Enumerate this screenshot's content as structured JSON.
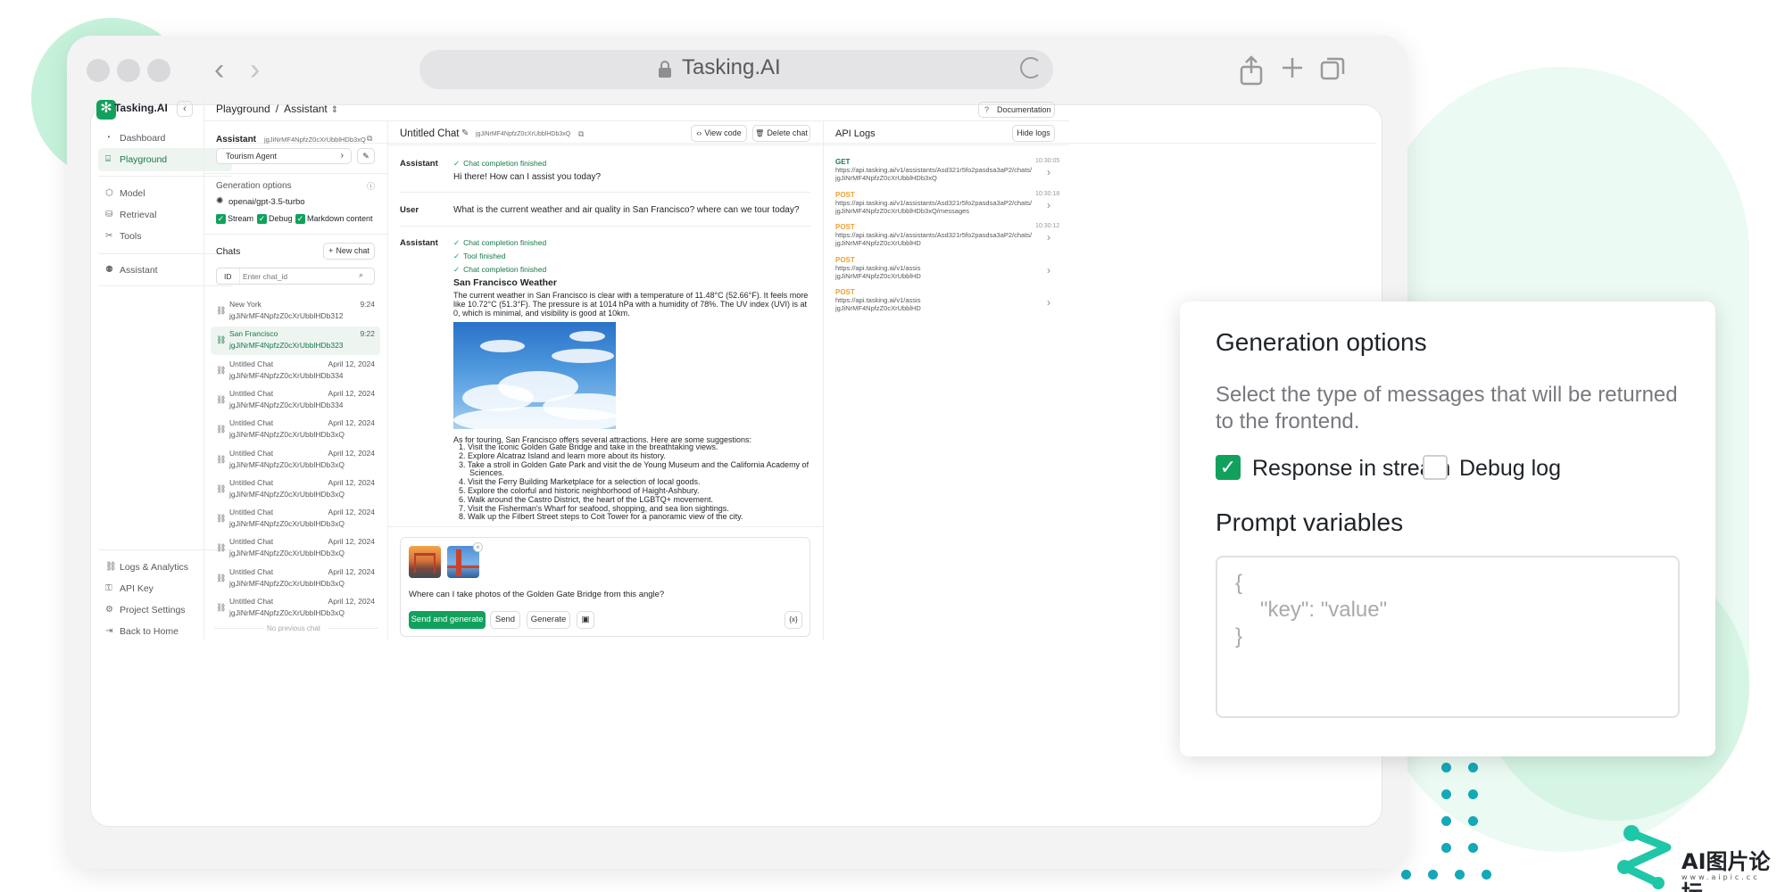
{
  "browser": {
    "url": "Tasking.AI"
  },
  "app": {
    "logo_text": "Tasking.AI",
    "accent": "#12a15c"
  },
  "sidebar": {
    "items_top": [
      {
        "label": "Dashboard",
        "icon": "gauge-icon"
      },
      {
        "label": "Playground",
        "icon": "terminal-icon",
        "active": true
      }
    ],
    "items_mid": [
      {
        "label": "Model",
        "icon": "cube-icon"
      },
      {
        "label": "Retrieval",
        "icon": "database-icon"
      },
      {
        "label": "Tools",
        "icon": "tools-icon"
      }
    ],
    "items_assist": [
      {
        "label": "Assistant",
        "icon": "assistant-icon"
      }
    ],
    "items_bottom": [
      {
        "label": "Logs & Analytics",
        "icon": "link-icon"
      },
      {
        "label": "API Key",
        "icon": "key-icon"
      },
      {
        "label": "Project Settings",
        "icon": "gear-icon"
      },
      {
        "label": "Back to Home",
        "icon": "exit-icon"
      }
    ]
  },
  "header": {
    "breadcrumb_1": "Playground",
    "breadcrumb_sep": "/",
    "breadcrumb_2": "Assistant",
    "docs_label": "Documentation"
  },
  "assistant_panel": {
    "title": "Assistant",
    "id": "jgJiNrMF4NpfzZ0cXrUbblHDb3xQ",
    "selected": "Tourism Agent",
    "gen_title": "Generation options",
    "model": "openai/gpt-3.5-turbo",
    "checks": [
      "Stream",
      "Debug",
      "Markdown content"
    ]
  },
  "chats": {
    "title": "Chats",
    "new_label": "New chat",
    "id_label": "ID",
    "search_placeholder": "Enter chat_id",
    "items": [
      {
        "title": "New York",
        "id": "jgJiNrMF4NpfzZ0cXrUbblHDb312",
        "time": "9:24"
      },
      {
        "title": "San Francisco",
        "id": "jgJiNrMF4NpfzZ0cXrUbblHDb323",
        "time": "9:22",
        "active": true
      },
      {
        "title": "Untitled Chat",
        "id": "jgJiNrMF4NpfzZ0cXrUbblHDb334",
        "time": "April 12, 2024"
      },
      {
        "title": "Untitled Chat",
        "id": "jgJiNrMF4NpfzZ0cXrUbblHDb334",
        "time": "April 12, 2024"
      },
      {
        "title": "Untitled Chat",
        "id": "jgJiNrMF4NpfzZ0cXrUbblHDb3xQ",
        "time": "April 12, 2024"
      },
      {
        "title": "Untitled Chat",
        "id": "jgJiNrMF4NpfzZ0cXrUbblHDb3xQ",
        "time": "April 12, 2024"
      },
      {
        "title": "Untitled Chat",
        "id": "jgJiNrMF4NpfzZ0cXrUbblHDb3xQ",
        "time": "April 12, 2024"
      },
      {
        "title": "Untitled Chat",
        "id": "jgJiNrMF4NpfzZ0cXrUbblHDb3xQ",
        "time": "April 12, 2024"
      },
      {
        "title": "Untitled Chat",
        "id": "jgJiNrMF4NpfzZ0cXrUbblHDb3xQ",
        "time": "April 12, 2024"
      },
      {
        "title": "Untitled Chat",
        "id": "jgJiNrMF4NpfzZ0cXrUbblHDb3xQ",
        "time": "April 12, 2024"
      },
      {
        "title": "Untitled Chat",
        "id": "jgJiNrMF4NpfzZ0cXrUbblHDb3xQ",
        "time": "April 12, 2024"
      }
    ],
    "footer": "No previous chat"
  },
  "chat": {
    "title": "Untitled Chat",
    "id": "jgJiNrMF4NpfzZ0cXrUbblHDb3xQ",
    "view_code": "View code",
    "delete_chat": "Delete chat",
    "messages": [
      {
        "role": "Assistant",
        "status": [
          "Chat completion finished"
        ],
        "text": "Hi there! How can I assist you today?"
      },
      {
        "role": "User",
        "text": "What is the current weather and air quality in San Francisco? where can we tour today?"
      },
      {
        "role": "Assistant",
        "status": [
          "Chat completion finished",
          "Tool finished",
          "Chat completion finished"
        ],
        "heading": "San Francisco Weather",
        "text": "The current weather in San Francisco is clear with a temperature of 11.48°C (52.66°F). It feels more like 10.72°C (51.3°F). The pressure is at 1014 hPa with a humidity of 78%. The UV index (UVI) is at 0, which is minimal, and visibility is good at 10km.",
        "intro": "As for touring, San Francisco offers several attractions. Here are some suggestions:",
        "list": [
          "1. Visit the iconic Golden Gate Bridge and take in the breathtaking views.",
          "2. Explore Alcatraz Island and learn more about its history.",
          "3. Take a stroll in Golden Gate Park and visit the de Young Museum and the California Academy of",
          "Sciences.",
          "4. Visit the Ferry Building Marketplace for a selection of local goods.",
          "5. Explore the colorful and historic neighborhood of Haight-Ashbury.",
          "6. Walk around the Castro District, the heart of the LGBTQ+ movement.",
          "7. Visit the Fisherman's Wharf for seafood, shopping, and sea lion sightings.",
          "8. Walk up the Filbert Street steps to Coit Tower for a panoramic view of the city."
        ]
      }
    ],
    "composer_text": "Where can I take photos of the Golden Gate Bridge from this angle?",
    "send_generate": "Send and generate",
    "send": "Send",
    "generate": "Generate",
    "var_icon": "{x}"
  },
  "logs": {
    "title": "API Logs",
    "hide": "Hide logs",
    "entries": [
      {
        "method": "GET",
        "color": "#13794a",
        "time": "10:30:05",
        "url1": "https://api.tasking.ai/v1/assistants/Asd321r5fo2pasdsa3aP2/chats/",
        "url2": "jgJiNrMF4NpfzZ0cXrUbblHDb3xQ"
      },
      {
        "method": "POST",
        "color": "#f0a030",
        "time": "10:30:18",
        "url1": "https://api.tasking.ai/v1/assistants/Asd321r5fo2pasdsa3aP2/chats/",
        "url2": "jgJiNrMF4NpfzZ0cXrUbblHDb3xQ/messages"
      },
      {
        "method": "POST",
        "color": "#f0a030",
        "time": "10:30:12",
        "url1": "https://api.tasking.ai/v1/assistants/Asd321r5fo2pasdsa3aP2/chats/",
        "url2": "jgJiNrMF4NpfzZ0cXrUbblHD"
      },
      {
        "method": "POST",
        "color": "#f0a030",
        "time": "",
        "url1": "https://api.tasking.ai/v1/assis",
        "url2": "jgJiNrMF4NpfzZ0cXrUbblHD"
      },
      {
        "method": "POST",
        "color": "#f0a030",
        "time": "",
        "url1": "https://api.tasking.ai/v1/assis",
        "url2": "jgJiNrMF4NpfzZ0cXrUbblHD"
      }
    ]
  },
  "popup": {
    "title": "Generation options",
    "desc": "Select the type of messages that will be returned to the frontend.",
    "opt_stream": "Response in stream",
    "opt_debug": "Debug log",
    "prompt_title": "Prompt variables",
    "placeholder_l1": "{",
    "placeholder_l2": "\"key\": \"value\"",
    "placeholder_l3": "}"
  },
  "watermark": {
    "text": "AI图片论坛",
    "sub": "www.aipic.cc"
  }
}
